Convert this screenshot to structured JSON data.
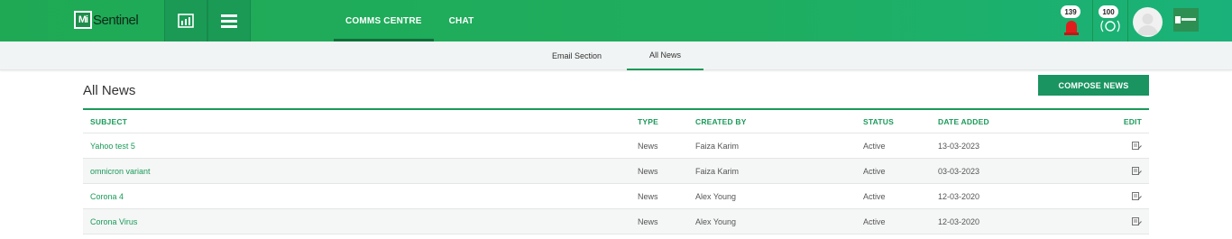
{
  "header": {
    "logo_mark": "Mi",
    "logo_text": "Sentinel",
    "tabs": [
      {
        "label": "COMMS CENTRE",
        "active": true
      },
      {
        "label": "CHAT",
        "active": false
      }
    ],
    "alert_count": "139",
    "notification_count": "100",
    "accent_color": "#1fa955"
  },
  "subnav": {
    "tabs": [
      {
        "label": "Email Section",
        "active": false
      },
      {
        "label": "All News",
        "active": true
      }
    ]
  },
  "main": {
    "title": "All News",
    "compose_label": "COMPOSE NEWS",
    "table": {
      "columns": [
        "SUBJECT",
        "TYPE",
        "CREATED BY",
        "STATUS",
        "DATE ADDED",
        "EDIT"
      ],
      "rows": [
        {
          "subject": "Yahoo test 5",
          "type": "News",
          "created_by": "Faiza Karim",
          "status": "Active",
          "date_added": "13-03-2023"
        },
        {
          "subject": "omnicron variant",
          "type": "News",
          "created_by": "Faiza Karim",
          "status": "Active",
          "date_added": "03-03-2023"
        },
        {
          "subject": "Corona 4",
          "type": "News",
          "created_by": "Alex Young",
          "status": "Active",
          "date_added": "12-03-2020"
        },
        {
          "subject": "Corona Virus",
          "type": "News",
          "created_by": "Alex Young",
          "status": "Active",
          "date_added": "12-03-2020"
        }
      ]
    }
  }
}
